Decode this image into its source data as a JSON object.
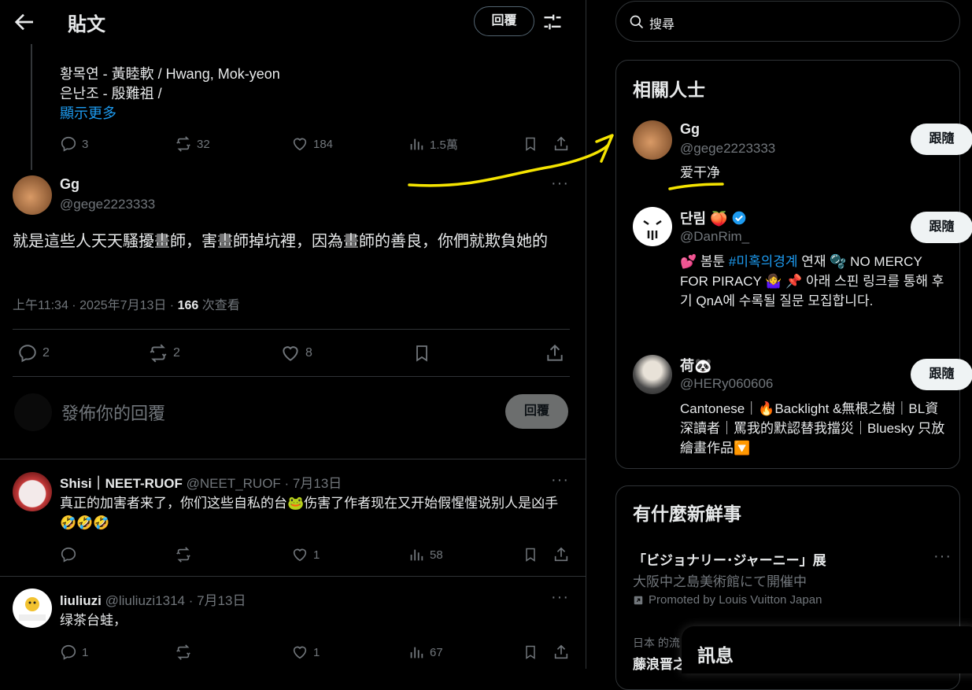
{
  "header": {
    "title": "貼文",
    "reply_button": "回覆"
  },
  "thread": {
    "lines": [
      "황목연 - 黃睦軟 / Hwang, Mok-yeon",
      "은난조 - 殷難祖 /"
    ],
    "show_more": "顯示更多",
    "stats": {
      "replies": "3",
      "reposts": "32",
      "likes": "184",
      "views": "1.5萬"
    }
  },
  "tweet": {
    "name": "Gg",
    "handle": "@gege2223333",
    "text": "就是這些人天天騷擾畫師，害畫師掉坑裡，因為畫師的善良，你們就欺負她的",
    "time": "上午11:34 · 2025年7月13日 · ",
    "views_count": "166",
    "views_label": " 次查看",
    "stats": {
      "replies": "2",
      "reposts": "2",
      "likes": "8"
    }
  },
  "compose": {
    "placeholder": "發佈你的回覆",
    "button": "回覆"
  },
  "replies": [
    {
      "name": "Shisi｜NEET-RUOF",
      "meta": "@NEET_RUOF · 7月13日",
      "text": "真正的加害者来了，你们这些自私的台🐸伤害了作者现在又开始假惺惺说别人是凶手🤣🤣🤣",
      "replies": "",
      "reposts": "",
      "likes": "1",
      "views": "58"
    },
    {
      "name": "liuliuzi",
      "meta": "@liuliuzi1314 · 7月13日",
      "text": "绿茶台蛙，",
      "replies": "1",
      "reposts": "",
      "likes": "1",
      "views": "67"
    }
  ],
  "search": {
    "placeholder": "搜尋"
  },
  "related": {
    "title": "相關人士",
    "people": [
      {
        "name": "Gg",
        "handle": "@gege2223333",
        "bio": "爱干净",
        "follow": "跟隨"
      },
      {
        "name": "단림 🍑",
        "handle": "@DanRim_",
        "bio_prefix": "💕 봄툰 ",
        "bio_tag": "#미혹의경계",
        "bio_rest": " 연재 🫧 NO MERCY FOR PIRACY 🤷‍♀️ 📌 아래 스핀 링크를 통해 후기 QnA에 수록될 질문 모집합니다.",
        "follow": "跟隨"
      },
      {
        "name": "荷🐼",
        "handle": "@HERy060606",
        "bio": "Cantonese｜🔥Backlight &無根之樹｜BL資深讀者｜罵我的默認替我擋災｜Bluesky 只放繪畫作品🔽",
        "follow": "跟隨"
      }
    ]
  },
  "trends": {
    "title": "有什麼新鮮事",
    "items": [
      {
        "title": "「ビジョナリー･ジャーニー」展",
        "subtitle": "大阪中之島美術館にて開催中",
        "promo": "Promoted by Louis Vuitton Japan"
      },
      {
        "context": "日本 的流",
        "title": "藤浪晋之"
      }
    ]
  },
  "messages": {
    "title": "訊息"
  },
  "colors": {
    "accent": "#1d9bf0",
    "annotation": "#f5e400",
    "background": "#000000"
  }
}
